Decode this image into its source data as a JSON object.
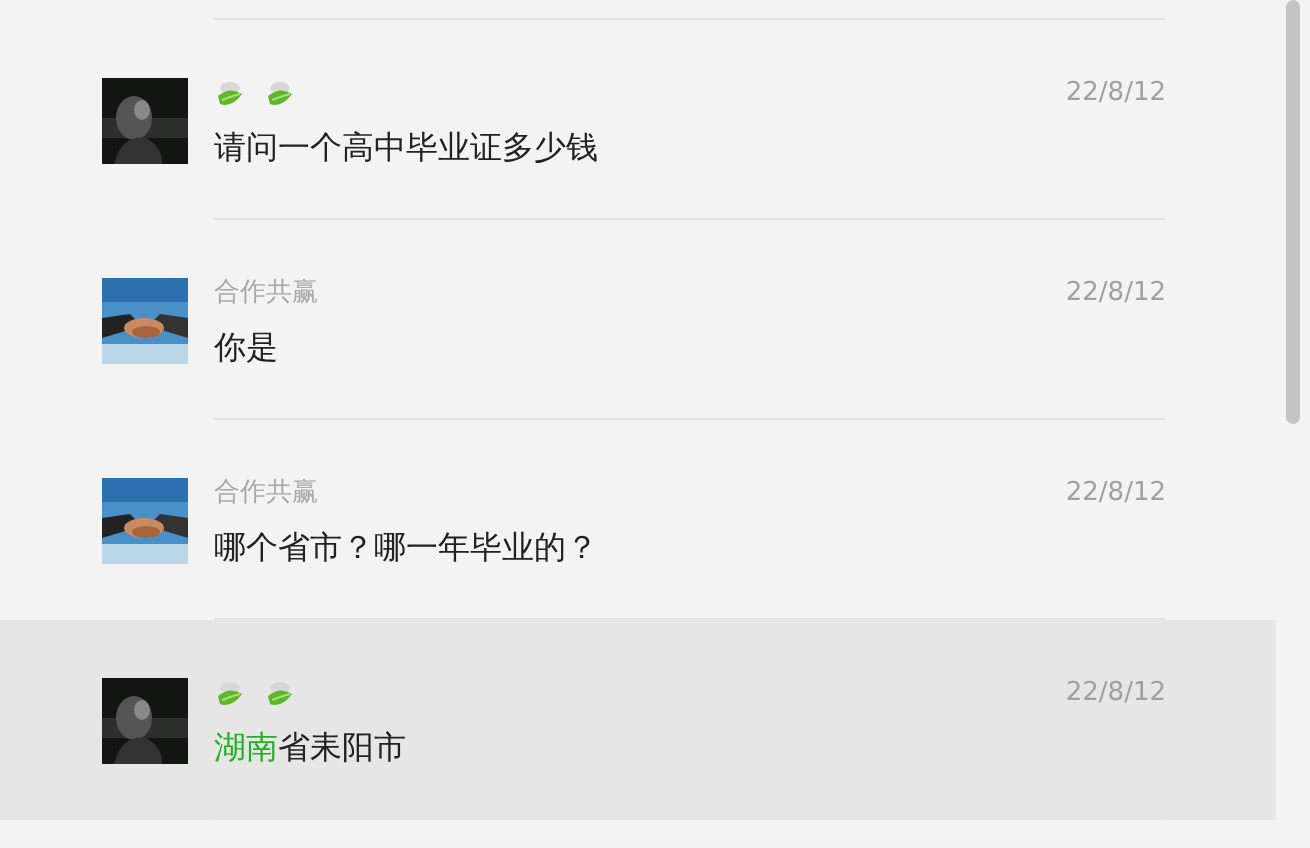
{
  "conversations": [
    {
      "avatar": {
        "kind": "picture"
      },
      "sender": {
        "kind": "leaf-icons"
      },
      "date": "22/8/12",
      "message": [
        {
          "text": "请问一个高中毕业证多少钱",
          "highlight": false
        }
      ],
      "selected": false
    },
    {
      "avatar": {
        "kind": "picture"
      },
      "sender": {
        "kind": "text",
        "text": "合作共赢"
      },
      "date": "22/8/12",
      "message": [
        {
          "text": "你是",
          "highlight": false
        }
      ],
      "selected": false
    },
    {
      "avatar": {
        "kind": "picture"
      },
      "sender": {
        "kind": "text",
        "text": "合作共赢"
      },
      "date": "22/8/12",
      "message": [
        {
          "text": "哪个省市？哪一年毕业的？",
          "highlight": false
        }
      ],
      "selected": false
    },
    {
      "avatar": {
        "kind": "picture"
      },
      "sender": {
        "kind": "leaf-icons"
      },
      "date": "22/8/12",
      "message": [
        {
          "text": "湖南",
          "highlight": true
        },
        {
          "text": "省耒阳市",
          "highlight": false
        }
      ],
      "selected": true
    }
  ]
}
